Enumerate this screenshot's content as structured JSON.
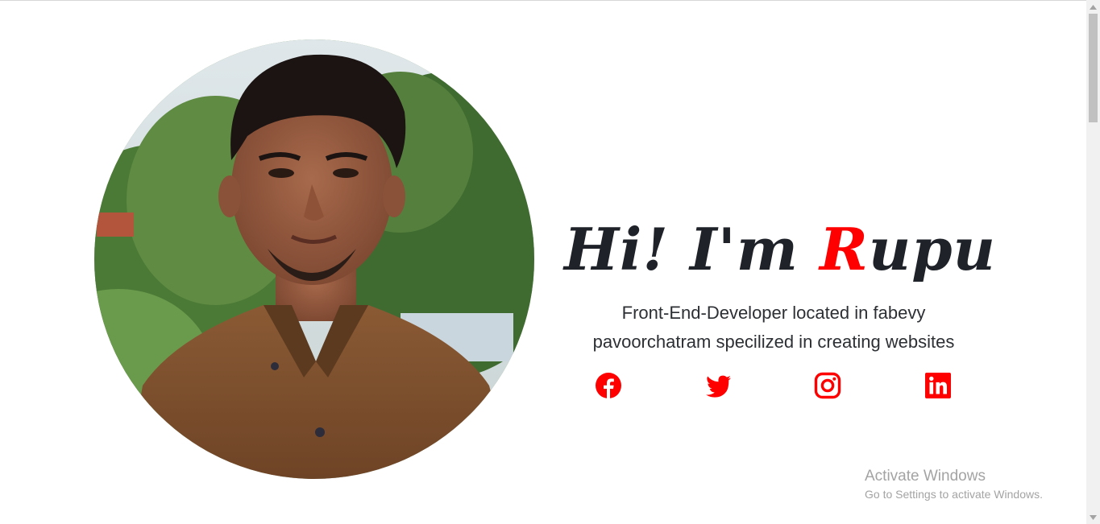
{
  "hero": {
    "greeting_prefix": "Hi! I'm ",
    "greeting_accent": "R",
    "greeting_suffix": "upu",
    "tagline_line1": "Front-End-Developer located in fabevy",
    "tagline_line2": "pavoorchatram specilized in creating websites"
  },
  "social_links": [
    {
      "name": "facebook",
      "icon": "facebook-icon"
    },
    {
      "name": "twitter",
      "icon": "twitter-icon"
    },
    {
      "name": "instagram",
      "icon": "instagram-icon"
    },
    {
      "name": "linkedin",
      "icon": "linkedin-icon"
    }
  ],
  "watermark": {
    "title": "Activate Windows",
    "subtitle": "Go to Settings to activate Windows."
  },
  "colors": {
    "accent": "#ff0000",
    "text": "#1f2329",
    "background": "#ffffff"
  }
}
